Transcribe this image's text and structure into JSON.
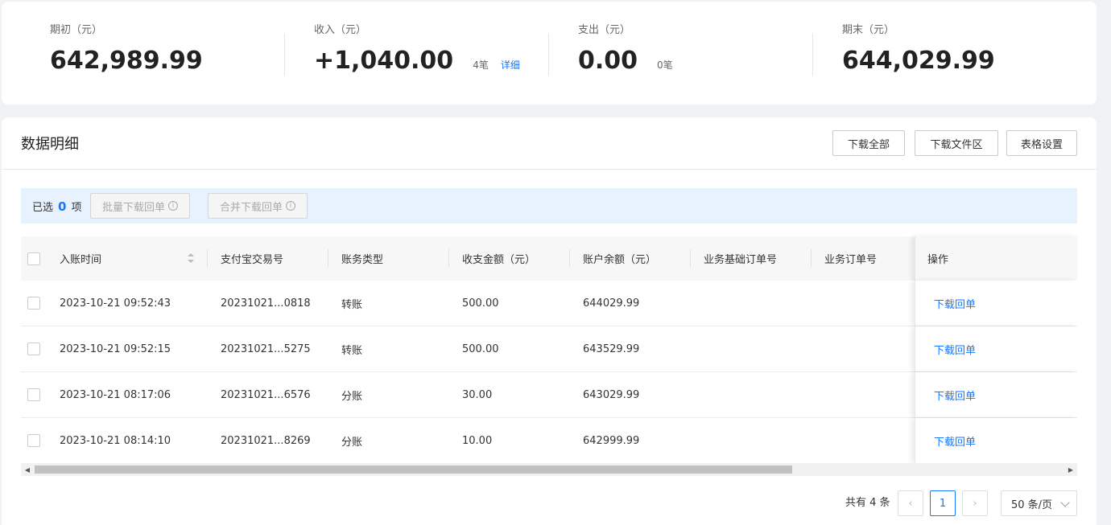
{
  "summary": {
    "opening": {
      "label": "期初（元）",
      "value": "642,989.99"
    },
    "income": {
      "label": "收入（元）",
      "value": "+1,040.00",
      "count": "4笔",
      "detail_link": "详细"
    },
    "expense": {
      "label": "支出（元）",
      "value": "0.00",
      "count": "0笔"
    },
    "closing": {
      "label": "期末（元）",
      "value": "644,029.99"
    }
  },
  "details": {
    "title": "数据明细",
    "buttons": {
      "download_all": "下载全部",
      "download_area": "下载文件区",
      "table_settings": "表格设置"
    },
    "selection": {
      "prefix": "已选",
      "count": "0",
      "suffix": "项",
      "batch_download": "批量下载回单",
      "merge_download": "合并下载回单"
    }
  },
  "table": {
    "columns": [
      "入账时间",
      "支付宝交易号",
      "账务类型",
      "收支金额（元）",
      "账户余额（元）",
      "业务基础订单号",
      "业务订单号",
      "操作"
    ],
    "rows": [
      {
        "time": "2023-10-21 09:52:43",
        "trade_no": "20231021...0818",
        "type": "转账",
        "amount": "500.00",
        "balance": "644029.99",
        "action": "下载回单"
      },
      {
        "time": "2023-10-21 09:52:15",
        "trade_no": "20231021...5275",
        "type": "转账",
        "amount": "500.00",
        "balance": "643529.99",
        "action": "下载回单"
      },
      {
        "time": "2023-10-21 08:17:06",
        "trade_no": "20231021...6576",
        "type": "分账",
        "amount": "30.00",
        "balance": "643029.99",
        "action": "下载回单"
      },
      {
        "time": "2023-10-21 08:14:10",
        "trade_no": "20231021...8269",
        "type": "分账",
        "amount": "10.00",
        "balance": "642999.99",
        "action": "下载回单"
      }
    ]
  },
  "pagination": {
    "total": "共有 4 条",
    "current_page": "1",
    "page_size": "50 条/页"
  },
  "colors": {
    "accent": "#1677ff",
    "selection_bg": "#e8f1fe"
  }
}
